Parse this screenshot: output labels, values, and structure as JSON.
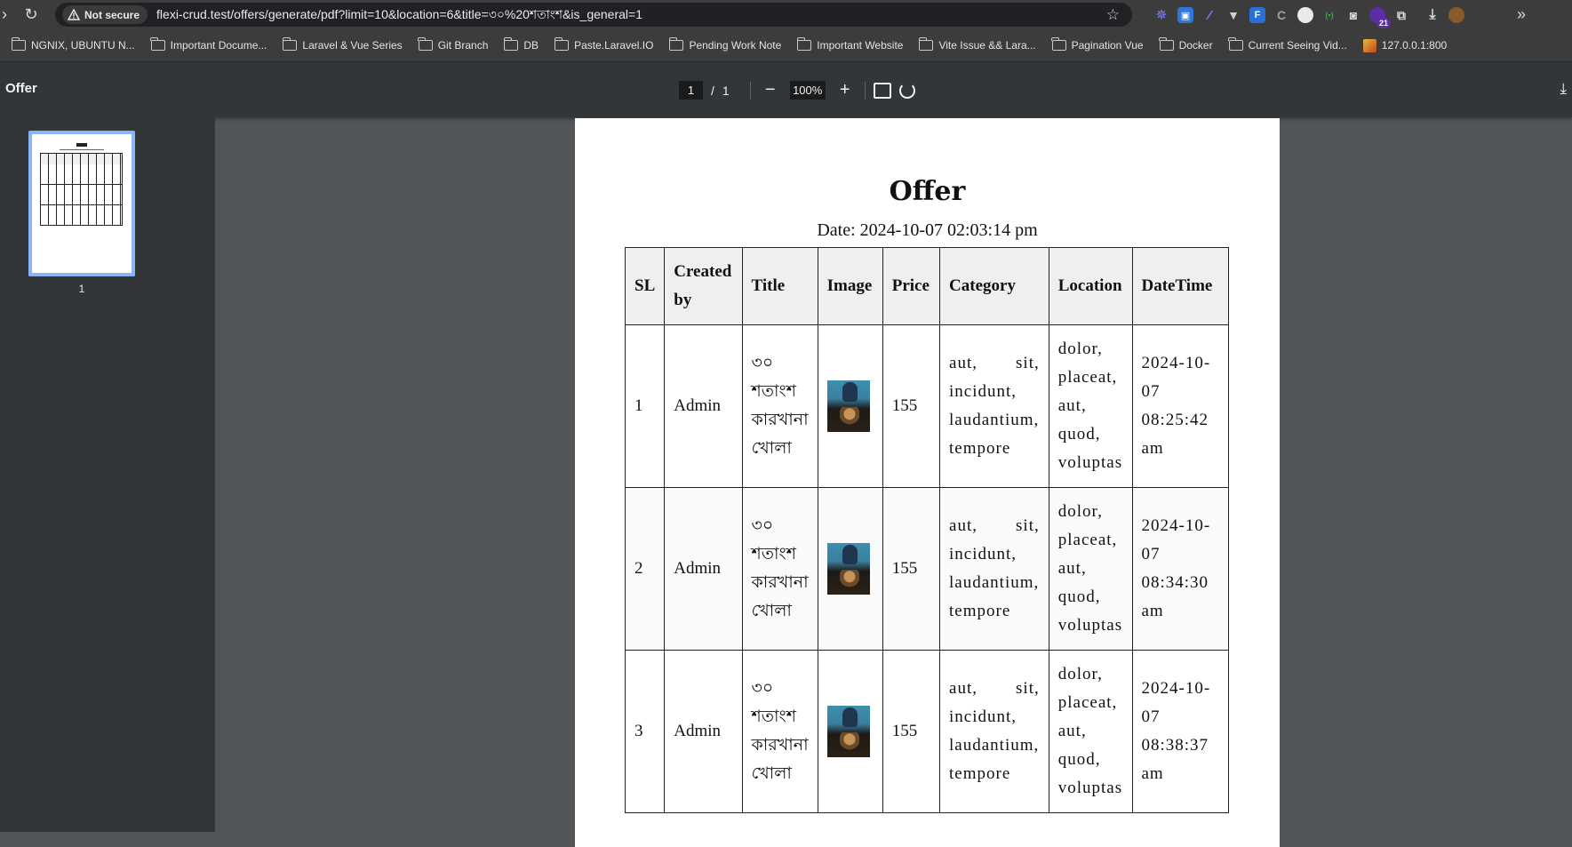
{
  "browser": {
    "security_label": "Not secure",
    "url": "flexi-crud.test/offers/generate/pdf?limit=10&location=6&title=৩০%20শতাংশ&is_general=1",
    "extension_badge": "21"
  },
  "bookmarks": [
    {
      "label": "NGNIX, UBUNTU N...",
      "icon": "folder-icon"
    },
    {
      "label": "Important Docume...",
      "icon": "folder-icon"
    },
    {
      "label": "Laravel & Vue Series",
      "icon": "folder-icon"
    },
    {
      "label": "Git Branch",
      "icon": "folder-icon"
    },
    {
      "label": "DB",
      "icon": "folder-icon"
    },
    {
      "label": "Paste.Laravel.IO",
      "icon": "folder-icon"
    },
    {
      "label": "Pending Work Note",
      "icon": "folder-icon"
    },
    {
      "label": "Important Website",
      "icon": "folder-icon"
    },
    {
      "label": "Vite Issue && Lara...",
      "icon": "folder-icon"
    },
    {
      "label": "Pagination Vue",
      "icon": "folder-icon"
    },
    {
      "label": "Docker",
      "icon": "folder-icon"
    },
    {
      "label": "Current Seeing Vid...",
      "icon": "folder-icon"
    },
    {
      "label": "127.0.0.1:800",
      "icon": "site-icon"
    }
  ],
  "viewer": {
    "doc_title": "Offer",
    "current_page": "1",
    "page_separator": "/",
    "total_pages": "1",
    "zoom": "100%",
    "thumbnail_label": "1"
  },
  "document": {
    "title": "Offer",
    "date_label": "Date:",
    "date_value": "2024-10-07 02:03:14 pm",
    "columns": [
      "SL",
      "Created by",
      "Title",
      "Image",
      "Price",
      "Category",
      "Location",
      "DateTime"
    ],
    "rows": [
      {
        "sl": "1",
        "created_by": "Admin",
        "title": "৩০ শতাংশ কারখানা খোলা",
        "price": "155",
        "category": "aut, sit, incidunt, laudantium, tempore",
        "location": "dolor, placeat, aut, quod, voluptas",
        "datetime": "2024-10-07 08:25:42 am"
      },
      {
        "sl": "2",
        "created_by": "Admin",
        "title": "৩০ শতাংশ কারখানা খোলা",
        "price": "155",
        "category": "aut, sit, incidunt, laudantium, tempore",
        "location": "dolor, placeat, aut, quod, voluptas",
        "datetime": "2024-10-07 08:34:30 am"
      },
      {
        "sl": "3",
        "created_by": "Admin",
        "title": "৩০ শতাংশ কারখানা খোলা",
        "price": "155",
        "category": "aut, sit, incidunt, laudantium, tempore",
        "location": "dolor, placeat, aut, quod, voluptas",
        "datetime": "2024-10-07 08:38:37 am"
      }
    ]
  },
  "colors": {
    "chrome_bg": "#3c3c3c",
    "toolbar_bg": "#323639",
    "viewer_bg": "#525659",
    "thumb_border": "#8ab4f8"
  }
}
